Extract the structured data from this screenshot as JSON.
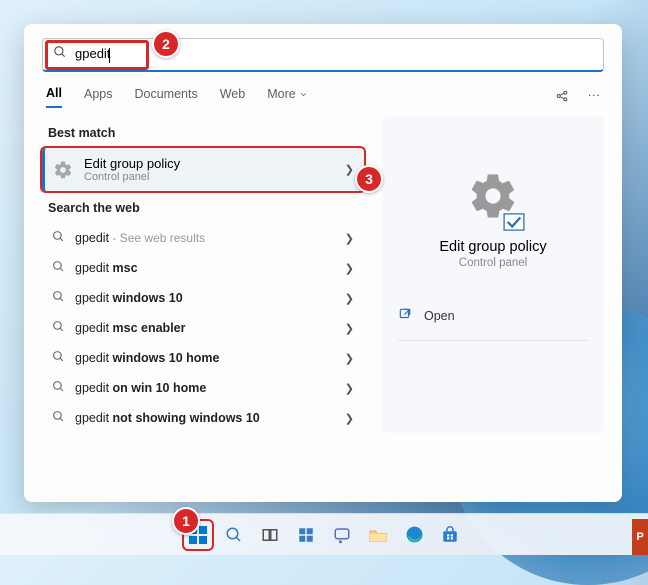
{
  "search": {
    "query": "gpedit"
  },
  "tabs": {
    "all": "All",
    "apps": "Apps",
    "documents": "Documents",
    "web": "Web",
    "more": "More"
  },
  "sections": {
    "best_match": "Best match",
    "search_web": "Search the web"
  },
  "best_match": {
    "title": "Edit group policy",
    "subtitle": "Control panel"
  },
  "web_results": [
    {
      "prefix": "gpedit",
      "bold": "",
      "suffix": "",
      "hint": " - See web results"
    },
    {
      "prefix": "gpedit ",
      "bold": "msc",
      "suffix": "",
      "hint": ""
    },
    {
      "prefix": "gpedit ",
      "bold": "windows 10",
      "suffix": "",
      "hint": ""
    },
    {
      "prefix": "gpedit ",
      "bold": "msc enabler",
      "suffix": "",
      "hint": ""
    },
    {
      "prefix": "gpedit ",
      "bold": "windows 10 home",
      "suffix": "",
      "hint": ""
    },
    {
      "prefix": "gpedit ",
      "bold": "on win 10 home",
      "suffix": "",
      "hint": ""
    },
    {
      "prefix": "gpedit ",
      "bold": "not showing windows 10",
      "suffix": "",
      "hint": ""
    }
  ],
  "preview": {
    "title": "Edit group policy",
    "subtitle": "Control panel",
    "open": "Open"
  },
  "callouts": {
    "one": "1",
    "two": "2",
    "three": "3"
  }
}
